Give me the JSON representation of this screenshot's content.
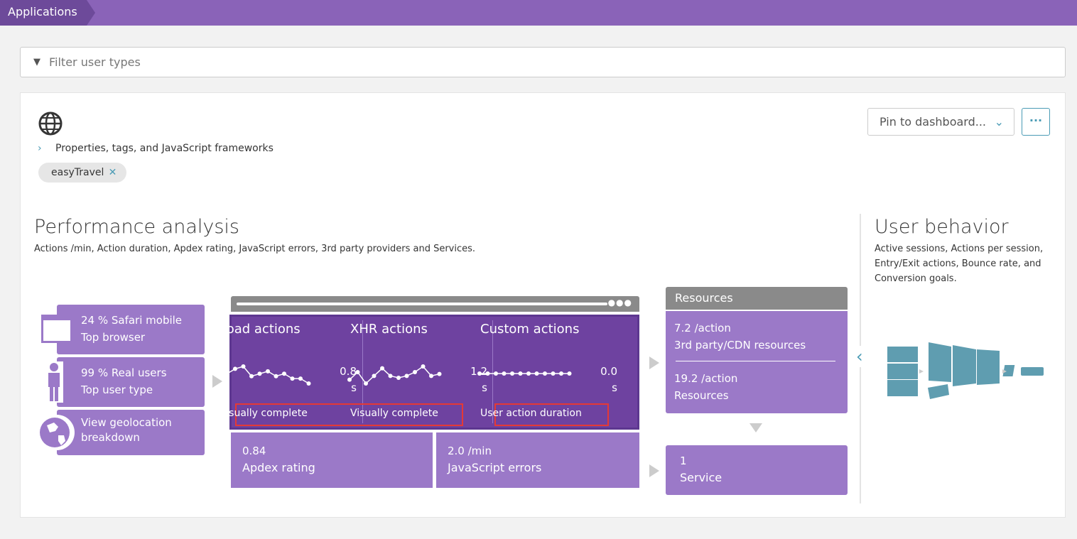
{
  "topbar": {
    "breadcrumb": "Applications"
  },
  "filter": {
    "placeholder": "Filter user types",
    "icon": "filter-icon"
  },
  "app": {
    "icon": "globe-icon",
    "properties_link": "Properties, tags, and JavaScript frameworks",
    "tag": "easyTravel",
    "pin_button": "Pin to dashboard...",
    "more_button": "···"
  },
  "performance": {
    "title": "Performance analysis",
    "subtitle": "Actions /min, Action duration, Apdex rating, JavaScript errors, 3rd party providers and Services.",
    "left_tiles": [
      {
        "line1": "24 % Safari mobile",
        "line2": "Top browser",
        "icon": "browser-icon"
      },
      {
        "line1": "99 % Real users",
        "line2": "Top user type",
        "icon": "user-icon"
      },
      {
        "line1": "View geolocation",
        "line2": "breakdown",
        "icon": "globe-icon"
      }
    ],
    "actions": [
      {
        "title": "Load actions",
        "value": "0.8",
        "unit": "s",
        "metric": "Visually complete",
        "spark": [
          0.8,
          0.78,
          0.8,
          0.81,
          0.77,
          0.78,
          0.79,
          0.77,
          0.78,
          0.76,
          0.76,
          0.74
        ]
      },
      {
        "title": "XHR actions",
        "value": "1.2",
        "unit": "s",
        "metric": "Visually complete",
        "spark": [
          1.1,
          1.3,
          1.0,
          1.2,
          1.4,
          1.2,
          1.15,
          1.2,
          1.3,
          1.45,
          1.2,
          1.25
        ]
      },
      {
        "title": "Custom actions",
        "value": "0.0",
        "unit": "s",
        "metric": "User action duration",
        "spark": [
          0,
          0,
          0,
          0,
          0,
          0,
          0,
          0,
          0,
          0,
          0,
          0
        ]
      }
    ],
    "apdex": {
      "value": "0.84",
      "label": "Apdex rating"
    },
    "js_errors": {
      "value": "2.0 /min",
      "label": "JavaScript errors"
    },
    "resources": {
      "header": "Resources",
      "r1_value": "7.2 /action",
      "r1_label": "3rd party/CDN resources",
      "r2_value": "19.2 /action",
      "r2_label": "Resources"
    },
    "service": {
      "value": "1",
      "label": "Service"
    }
  },
  "behavior": {
    "title": "User behavior",
    "subtitle": "Active sessions, Actions per session, Entry/Exit actions, Bounce rate, and Conversion goals."
  },
  "colors": {
    "tile": "#9b79c8",
    "tile_dark": "#6e42a0",
    "highlight": "#e53935",
    "behavior": "#5f9db0"
  }
}
